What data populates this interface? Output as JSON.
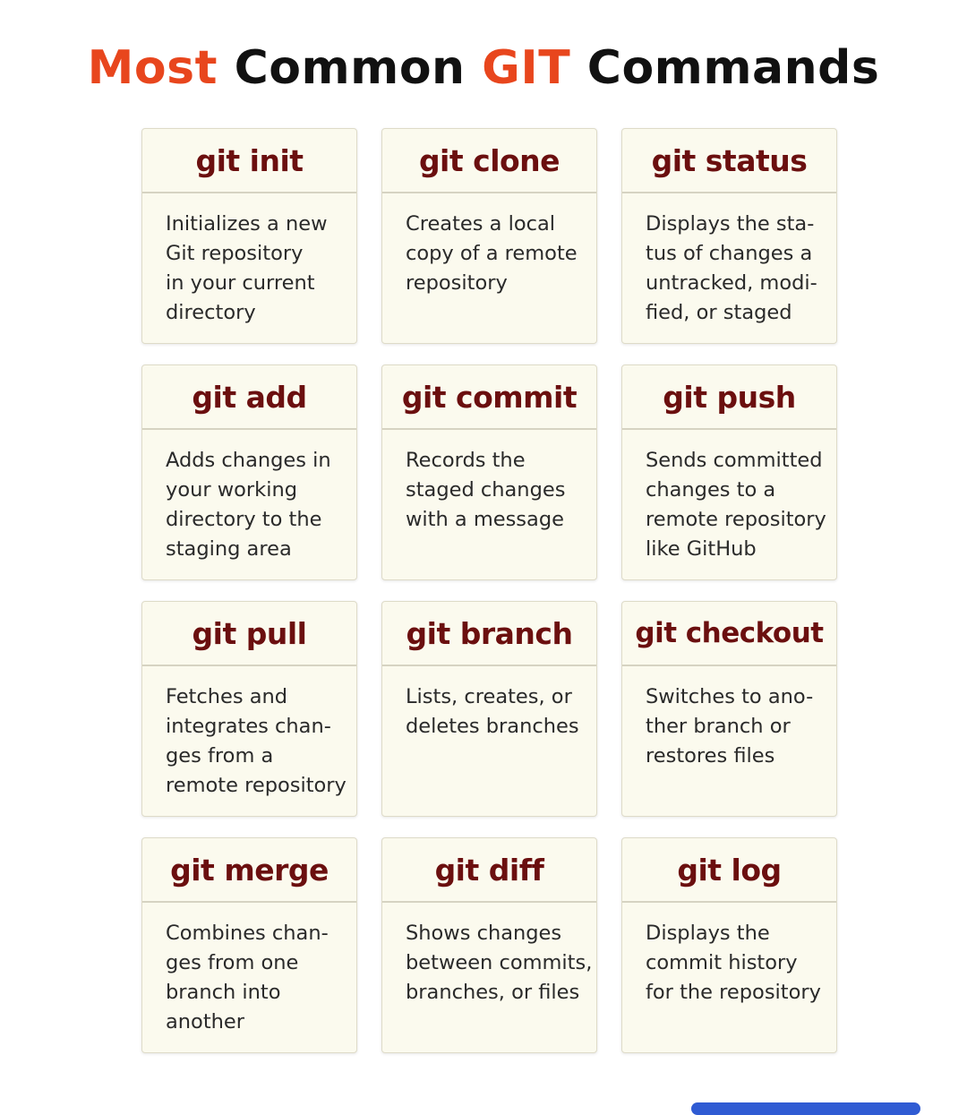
{
  "title": {
    "word1": "Most",
    "word2": "Common",
    "word3": "GIT",
    "word4": "Commands"
  },
  "colors": {
    "accent": "#e8461d",
    "command": "#6b0f0f",
    "card_bg": "#fbfaee",
    "card_border": "#dedbc8",
    "bottom_bar": "#2f5bd3"
  },
  "cards": [
    {
      "command": "git init",
      "lines": [
        "Initializes a new",
        "Git repository",
        "in your current",
        "directory"
      ]
    },
    {
      "command": "git clone",
      "lines": [
        "Creates a local",
        "copy of a remote",
        "repository"
      ]
    },
    {
      "command": "git status",
      "lines": [
        "Displays the sta-",
        "tus of changes a",
        "untracked, modi-",
        "fied, or staged"
      ]
    },
    {
      "command": "git add",
      "lines": [
        "Adds changes in",
        "your working",
        "directory to the",
        "staging area"
      ]
    },
    {
      "command": "git commit",
      "lines": [
        "Records the",
        "staged changes",
        "with a message"
      ]
    },
    {
      "command": "git push",
      "lines": [
        "Sends committed",
        "changes to a",
        "remote repository",
        "like GitHub"
      ]
    },
    {
      "command": "git pull",
      "lines": [
        "Fetches and",
        "integrates chan-",
        "ges from a",
        "remote repository"
      ]
    },
    {
      "command": "git branch",
      "lines": [
        "Lists, creates, or",
        "deletes branches"
      ]
    },
    {
      "command": "git checkout",
      "lines": [
        "Switches to ano-",
        "ther branch or",
        "restores files"
      ]
    },
    {
      "command": "git merge",
      "lines": [
        "Combines chan-",
        "ges from one",
        "branch into",
        "another"
      ]
    },
    {
      "command": "git diff",
      "lines": [
        "Shows changes",
        "between commits,",
        "branches, or files"
      ]
    },
    {
      "command": "git log",
      "lines": [
        "Displays the",
        "commit history",
        "for the repository"
      ]
    }
  ]
}
